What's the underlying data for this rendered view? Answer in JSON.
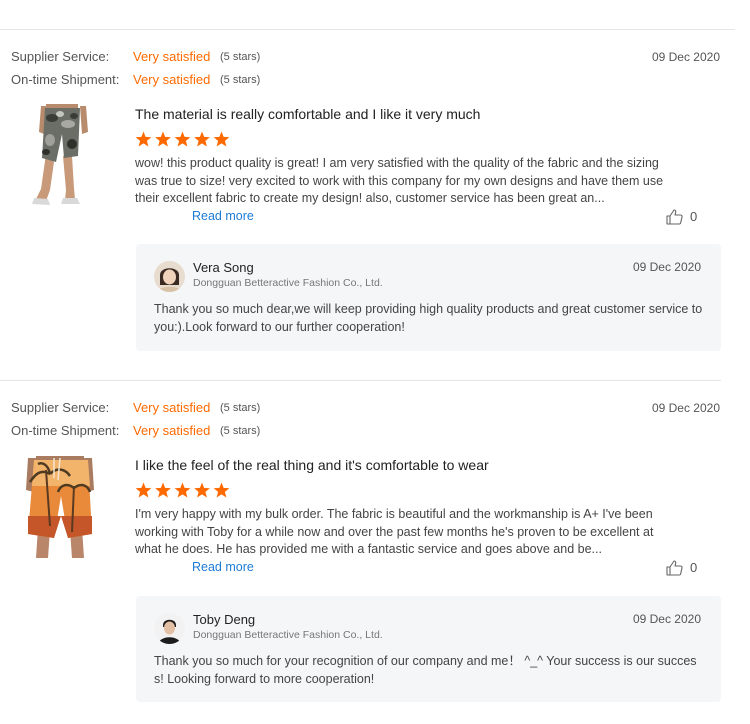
{
  "reviews": [
    {
      "supplier_service_label": "Supplier Service:",
      "supplier_service_value": "Very satisfied",
      "supplier_service_stars": "(5 stars)",
      "shipment_label": "On-time Shipment:",
      "shipment_value": "Very satisfied",
      "shipment_stars": "(5 stars)",
      "date": "09 Dec 2020",
      "product_image": "camouflage-shorts-photo",
      "title": "The material is really comfortable and I like it very much",
      "star_count": 5,
      "body": "wow! this product quality is great! I am very satisfied with the quality of the fabric and the sizing was true to size! very excited to work with this company for my own designs and have them use their excellent fabric to create my design! also, customer service has been great an...",
      "read_more": "Read more",
      "like_icon": "thumbs-up-icon",
      "likes": "0",
      "reply": {
        "name": "Vera Song",
        "company": "Dongguan Betteractive Fashion Co., Ltd.",
        "date": "09 Dec 2020",
        "text": "Thank you so much dear,we will keep providing high quality products and great customer service to you:).Look forward to our further cooperation!"
      }
    },
    {
      "supplier_service_label": "Supplier Service:",
      "supplier_service_value": "Very satisfied",
      "supplier_service_stars": "(5 stars)",
      "shipment_label": "On-time Shipment:",
      "shipment_value": "Very satisfied",
      "shipment_stars": "(5 stars)",
      "date": "09 Dec 2020",
      "product_image": "palm-print-shorts-photo",
      "title": "I like the feel of the real thing and it's comfortable to wear",
      "star_count": 5,
      "body": "I'm very happy with my bulk order. The fabric is beautiful and the workmanship is A+ I've been working with Toby for a while now and over the past few months he's proven to be excellent at what he does. He has provided me with a fantastic service and goes above and be...",
      "read_more": "Read more",
      "like_icon": "thumbs-up-icon",
      "likes": "0",
      "reply": {
        "name": "Toby Deng",
        "company": "Dongguan Betteractive Fashion Co., Ltd.",
        "date": "09 Dec 2020",
        "text": "Thank you so much for your recognition of our company and me！ ^_^ Your success is our success! Looking forward to more cooperation!"
      }
    }
  ],
  "colors": {
    "accent_orange": "#ff6a00",
    "link_blue": "#1e7bd6",
    "reply_bg": "#f5f6f8"
  }
}
